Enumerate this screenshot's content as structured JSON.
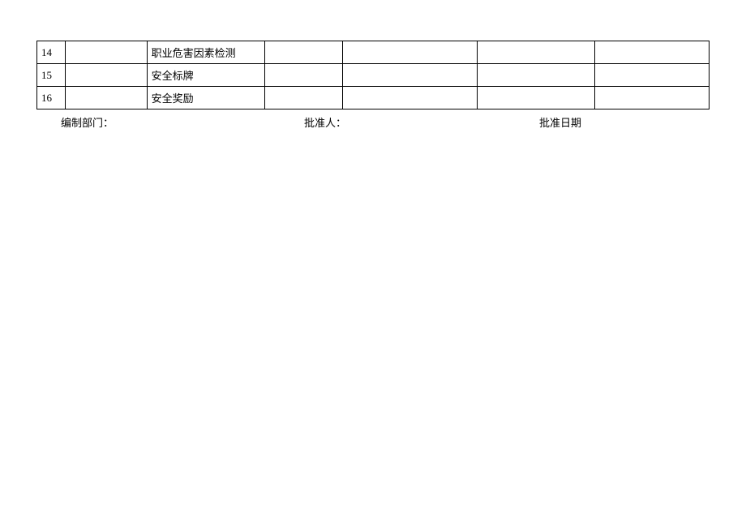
{
  "table": {
    "rows": [
      {
        "num": "14",
        "c1": "",
        "c2": "职业危害因素检测",
        "c3": "",
        "c4": "",
        "c5": "",
        "c6": ""
      },
      {
        "num": "15",
        "c1": "",
        "c2": "安全标牌",
        "c3": "",
        "c4": "",
        "c5": "",
        "c6": ""
      },
      {
        "num": "16",
        "c1": "",
        "c2": "安全奖励",
        "c3": "",
        "c4": "",
        "c5": "",
        "c6": ""
      }
    ]
  },
  "footer": {
    "dept_label": "编制部门：",
    "approver_label": "批准人：",
    "approve_date_label": "批准日期"
  }
}
